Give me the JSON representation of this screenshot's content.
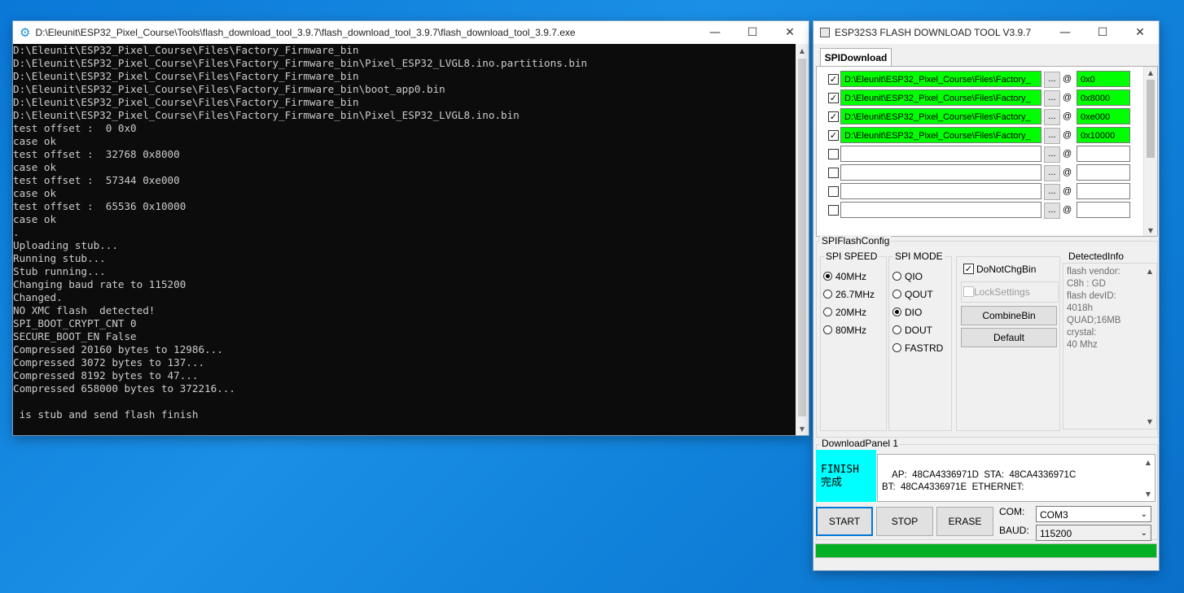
{
  "console": {
    "title": "D:\\Eleunit\\ESP32_Pixel_Course\\Tools\\flash_download_tool_3.9.7\\flash_download_tool_3.9.7\\flash_download_tool_3.9.7.exe",
    "output": "D:\\Eleunit\\ESP32_Pixel_Course\\Files\\Factory_Firmware_bin\nD:\\Eleunit\\ESP32_Pixel_Course\\Files\\Factory_Firmware_bin\\Pixel_ESP32_LVGL8.ino.partitions.bin\nD:\\Eleunit\\ESP32_Pixel_Course\\Files\\Factory_Firmware_bin\nD:\\Eleunit\\ESP32_Pixel_Course\\Files\\Factory_Firmware_bin\\boot_app0.bin\nD:\\Eleunit\\ESP32_Pixel_Course\\Files\\Factory_Firmware_bin\nD:\\Eleunit\\ESP32_Pixel_Course\\Files\\Factory_Firmware_bin\\Pixel_ESP32_LVGL8.ino.bin\ntest offset :  0 0x0\ncase ok\ntest offset :  32768 0x8000\ncase ok\ntest offset :  57344 0xe000\ncase ok\ntest offset :  65536 0x10000\ncase ok\n.\nUploading stub...\nRunning stub...\nStub running...\nChanging baud rate to 115200\nChanged.\nNO XMC flash  detected!\nSPI_BOOT_CRYPT_CNT 0\nSECURE_BOOT_EN False\nCompressed 20160 bytes to 12986...\nCompressed 3072 bytes to 137...\nCompressed 8192 bytes to 47...\nCompressed 658000 bytes to 372216...\n\n is stub and send flash finish"
  },
  "tool": {
    "title": "ESP32S3 FLASH DOWNLOAD TOOL V3.9.7",
    "tab": "SPIDownload",
    "at_symbol": "@",
    "dots_label": "...",
    "rows": [
      {
        "checked": true,
        "path": "D:\\Eleunit\\ESP32_Pixel_Course\\Files\\Factory_",
        "offset": "0x0"
      },
      {
        "checked": true,
        "path": "D:\\Eleunit\\ESP32_Pixel_Course\\Files\\Factory_",
        "offset": "0x8000"
      },
      {
        "checked": true,
        "path": "D:\\Eleunit\\ESP32_Pixel_Course\\Files\\Factory_",
        "offset": "0xe000"
      },
      {
        "checked": true,
        "path": "D:\\Eleunit\\ESP32_Pixel_Course\\Files\\Factory_",
        "offset": "0x10000"
      },
      {
        "checked": false,
        "path": "",
        "offset": ""
      },
      {
        "checked": false,
        "path": "",
        "offset": ""
      },
      {
        "checked": false,
        "path": "",
        "offset": ""
      },
      {
        "checked": false,
        "path": "",
        "offset": ""
      }
    ],
    "flash_config": {
      "title": "SPIFlashConfig",
      "spi_speed_title": "SPI SPEED",
      "spi_speed_options": [
        "40MHz",
        "26.7MHz",
        "20MHz",
        "80MHz"
      ],
      "spi_speed_selected": "40MHz",
      "spi_mode_title": "SPI MODE",
      "spi_mode_options": [
        "QIO",
        "QOUT",
        "DIO",
        "DOUT",
        "FASTRD"
      ],
      "spi_mode_selected": "DIO",
      "do_not_chg_bin": "DoNotChgBin",
      "lock_settings": "LockSettings",
      "combine_bin": "CombineBin",
      "default": "Default",
      "detected_title": "DetectedInfo",
      "detected_info": "flash vendor:\nC8h : GD\nflash devID:\n4018h\nQUAD;16MB\ncrystal:\n40 Mhz"
    },
    "download_panel": {
      "title": "DownloadPanel 1",
      "status_en": "FINISH",
      "status_cn": "完成",
      "mac_info": "AP:  48CA4336971D  STA:  48CA4336971C\nBT:  48CA4336971E  ETHERNET:",
      "start": "START",
      "stop": "STOP",
      "erase": "ERASE",
      "com_label": "COM:",
      "com_value": "COM3",
      "baud_label": "BAUD:",
      "baud_value": "115200",
      "progress": 1.0,
      "progress_color": "#06b025"
    }
  },
  "colors": {
    "finish_bg": "#00ffff",
    "path_ok": "#00ff00",
    "console_bg": "#0c0c0c"
  }
}
